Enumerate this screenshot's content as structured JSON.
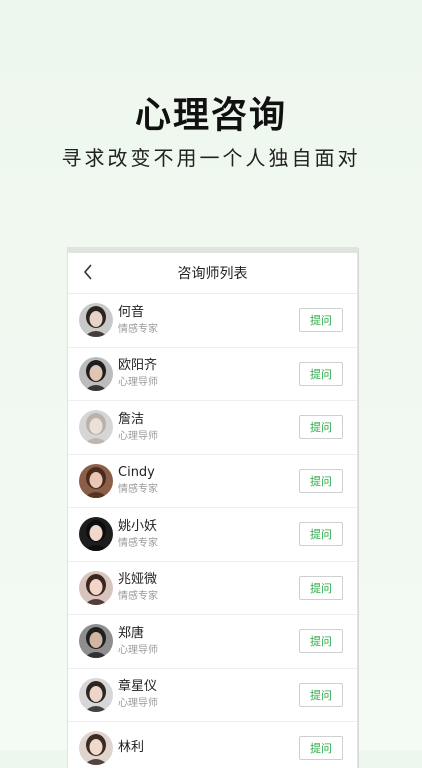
{
  "hero": {
    "title": "心理咨询",
    "subtitle": "寻求改变不用一个人独自面对"
  },
  "screen": {
    "nav_title": "咨询师列表",
    "back_icon": "chevron-left-icon"
  },
  "counselors": [
    {
      "name": "何音",
      "title": "情感专家",
      "button": "提问",
      "avatar": {
        "bg": "#c9c9c9",
        "hair": "#2b2522",
        "skin": "#e9d2c6"
      }
    },
    {
      "name": "欧阳齐",
      "title": "心理导师",
      "button": "提问",
      "avatar": {
        "bg": "#bcbcbc",
        "hair": "#1e1e1e",
        "skin": "#e1c5b4"
      }
    },
    {
      "name": "詹洁",
      "title": "心理导师",
      "button": "提问",
      "avatar": {
        "bg": "#d6d6d6",
        "hair": "#b8b2ac",
        "skin": "#efe0d6"
      }
    },
    {
      "name": "Cindy",
      "title": "情感专家",
      "button": "提问",
      "avatar": {
        "bg": "#8b5e48",
        "hair": "#4a2c1e",
        "skin": "#eac7b4"
      }
    },
    {
      "name": "姚小妖",
      "title": "情感专家",
      "button": "提问",
      "avatar": {
        "bg": "#1d1d1d",
        "hair": "#0d0d0d",
        "skin": "#f0d9cc"
      }
    },
    {
      "name": "兆娅微",
      "title": "情感专家",
      "button": "提问",
      "avatar": {
        "bg": "#d9c3bd",
        "hair": "#3a2620",
        "skin": "#f2d5c6"
      }
    },
    {
      "name": "郑唐",
      "title": "心理导师",
      "button": "提问",
      "avatar": {
        "bg": "#8e8e8e",
        "hair": "#202020",
        "skin": "#d2b5a2"
      }
    },
    {
      "name": "章星仪",
      "title": "心理导师",
      "button": "提问",
      "avatar": {
        "bg": "#d7d7d7",
        "hair": "#2c2622",
        "skin": "#ecd6c9"
      }
    },
    {
      "name": "林利",
      "title": "",
      "button": "提问",
      "avatar": {
        "bg": "#e0d4cf",
        "hair": "#3b2a24",
        "skin": "#f0d8cb"
      }
    }
  ],
  "colors": {
    "accent": "#2ea84a"
  }
}
